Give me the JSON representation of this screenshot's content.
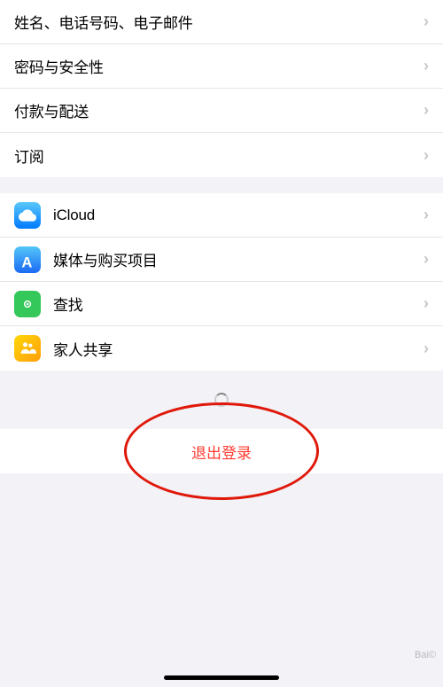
{
  "sections": {
    "account": {
      "items": [
        {
          "id": "name-phone-email",
          "label": "姓名、电话号码、电子邮件",
          "hasIcon": false
        },
        {
          "id": "password-security",
          "label": "密码与安全性",
          "hasIcon": false
        },
        {
          "id": "payment-delivery",
          "label": "付款与配送",
          "hasIcon": false
        },
        {
          "id": "subscriptions",
          "label": "订阅",
          "hasIcon": false
        }
      ]
    },
    "services": {
      "items": [
        {
          "id": "icloud",
          "label": "iCloud",
          "iconType": "icloud"
        },
        {
          "id": "media-purchases",
          "label": "媒体与购买项目",
          "iconType": "appstore"
        },
        {
          "id": "find-my",
          "label": "查找",
          "iconType": "findmy"
        },
        {
          "id": "family-sharing",
          "label": "家人共享",
          "iconType": "family"
        }
      ]
    },
    "logout": {
      "label": "退出登录"
    }
  },
  "chevron": "›",
  "icons": {
    "icloud": "☁",
    "appstore": "A",
    "findmy": "◎",
    "family": "👨‍👩‍👧"
  }
}
